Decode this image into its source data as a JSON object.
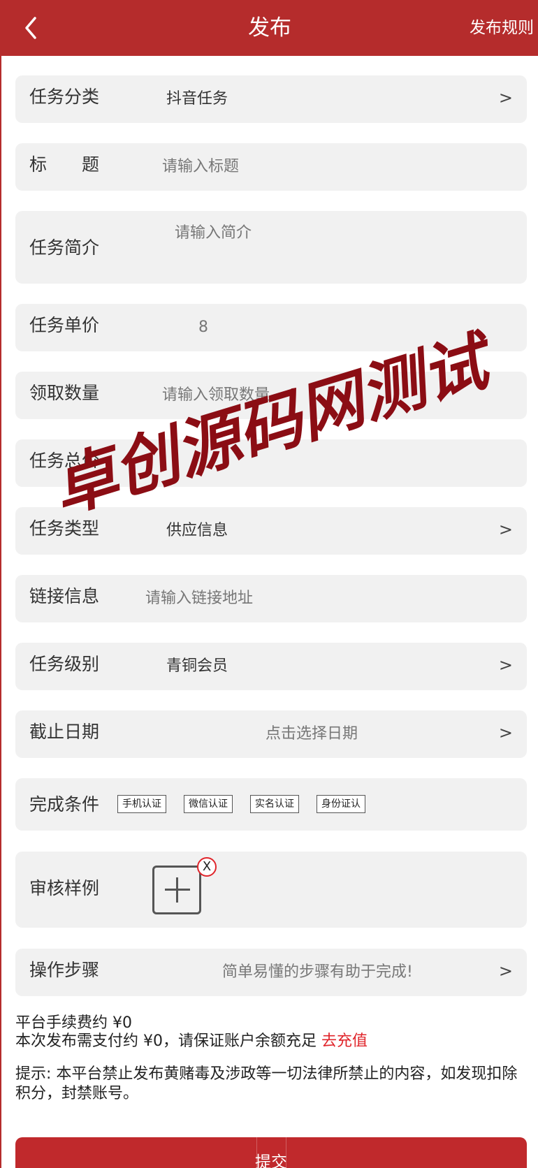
{
  "header": {
    "title": "发布",
    "rules_label": "发布规则"
  },
  "form": {
    "category": {
      "label": "任务分类",
      "value": "抖音任务",
      "arrow": ">"
    },
    "title": {
      "label": "标　　题",
      "placeholder": "请输入标题"
    },
    "intro": {
      "label": "任务简介",
      "placeholder": "请输入简介"
    },
    "unit_price": {
      "label": "任务单价",
      "value": "8"
    },
    "quantity": {
      "label": "领取数量",
      "placeholder": "请输入领取数量"
    },
    "total_price": {
      "label": "任务总价"
    },
    "type": {
      "label": "任务类型",
      "value": "供应信息",
      "arrow": ">"
    },
    "link": {
      "label": "链接信息",
      "placeholder": "请输入链接地址"
    },
    "level": {
      "label": "任务级别",
      "value": "青铜会员",
      "arrow": ">"
    },
    "deadline": {
      "label": "截止日期",
      "placeholder": "点击选择日期",
      "arrow": ">"
    },
    "conditions": {
      "label": "完成条件",
      "options": [
        "手机认证",
        "微信认证",
        "实名认证",
        "身份证认"
      ]
    },
    "sample": {
      "label": "审核样例",
      "close_glyph": "X"
    },
    "steps": {
      "label": "操作步骤",
      "placeholder": "简单易懂的步骤有助于完成!",
      "arrow": ">"
    }
  },
  "fees": {
    "platform_fee": "平台手续费约 ¥0",
    "payment_note": "本次发布需支付约 ¥0，请保证账户余额充足",
    "recharge_link": "去充值"
  },
  "notice": "提示: 本平台禁止发布黄赌毒及涉政等一切法律所禁止的内容，如发现扣除积分，封禁账号。",
  "submit_label": "提交",
  "watermark": {
    "text": "卓创源码网测试",
    "color": "#8b0d14"
  },
  "colors": {
    "brand": "#b52c2c",
    "accent_red": "#e0252b",
    "row_bg": "#f1f1f1"
  }
}
